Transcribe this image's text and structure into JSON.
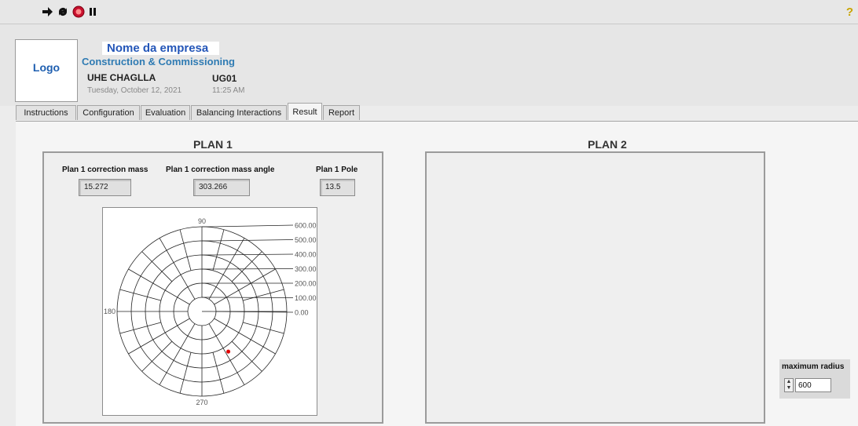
{
  "toolbar": {
    "icons": [
      "run-arrow-icon",
      "run-continuously-icon",
      "abort-stop-icon",
      "pause-icon"
    ],
    "help_icon": "?"
  },
  "header": {
    "logo_label": "Logo",
    "company_name": "Nome da empresa",
    "department": "Construction & Commissioning",
    "plant": "UHE CHAGLLA",
    "date": "Tuesday, October 12, 2021",
    "unit": "UG01",
    "time": "11:25 AM"
  },
  "tabs": [
    {
      "label": "Instructions"
    },
    {
      "label": "Configuration"
    },
    {
      "label": "Evaluation"
    },
    {
      "label": "Balancing Interactions"
    },
    {
      "label": "Result",
      "active": true
    },
    {
      "label": "Report"
    }
  ],
  "plan1": {
    "title": "PLAN 1",
    "mass_label": "Plan 1 correction mass",
    "mass_value": "15.272",
    "angle_label": "Plan 1 correction mass angle",
    "angle_value": "303.266",
    "pole_label": "Plan 1 Pole",
    "pole_value": "13.5",
    "polar": {
      "angle_labels": {
        "top": "90",
        "left": "180",
        "bottom": "270"
      },
      "radial_labels": [
        "600.00",
        "500.00",
        "400.00",
        "300.00",
        "200.00",
        "100.00",
        "0.00"
      ],
      "max_radius": 600,
      "point": {
        "r": 340,
        "angle_deg": 303.266
      },
      "point_color": "#e00000"
    }
  },
  "plan2": {
    "title": "PLAN 2"
  },
  "max_radius": {
    "label": "maximum radius",
    "value": "600"
  },
  "colors": {
    "company_blue": "#2456b8",
    "accent_blue": "#2f7bb3"
  }
}
